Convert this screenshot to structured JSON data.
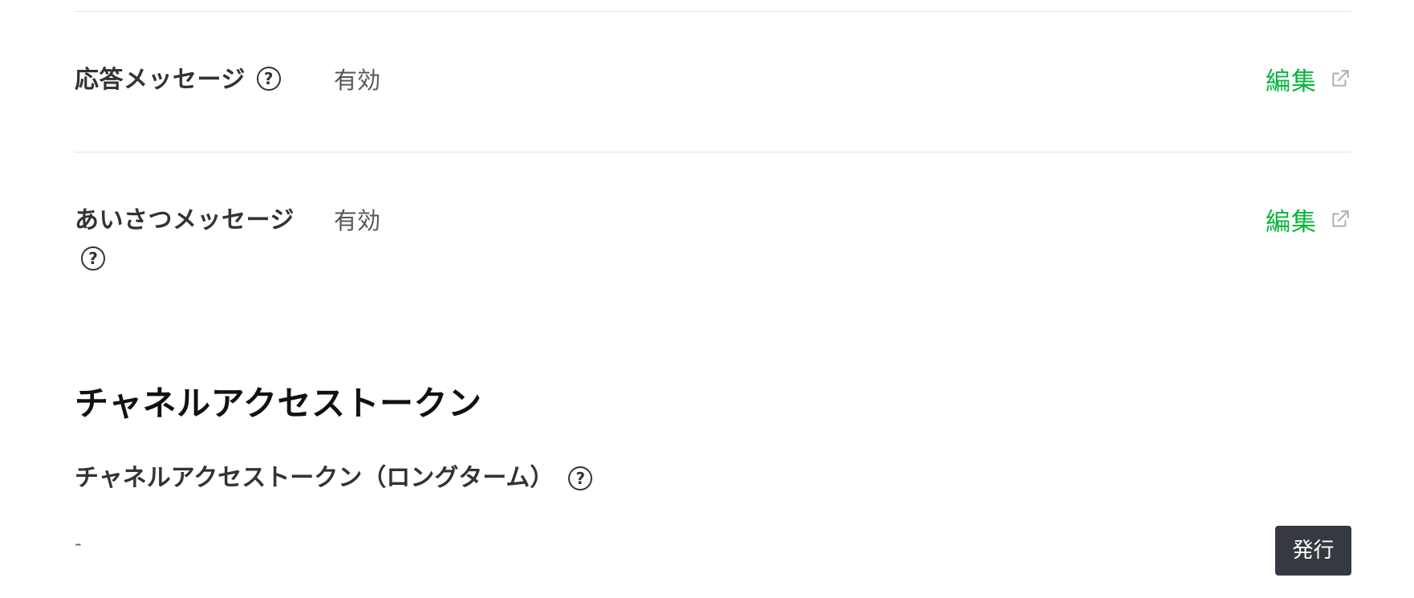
{
  "messaging_settings": {
    "rows": [
      {
        "label": "応答メッセージ",
        "value": "有効",
        "edit_label": "編集"
      },
      {
        "label": "あいさつメッセージ",
        "value": "有効",
        "edit_label": "編集"
      }
    ],
    "help_glyph": "?"
  },
  "channel_access_token": {
    "heading": "チャネルアクセストークン",
    "long_term": {
      "label": "チャネルアクセストークン（ロングターム）",
      "value": "-",
      "issue_button_label": "発行"
    }
  },
  "colors": {
    "link": "#07b53b",
    "button_bg": "#343a40",
    "divider": "#e5e5e5"
  },
  "icons": {
    "help": "question-circle-icon",
    "external": "external-link-icon"
  }
}
